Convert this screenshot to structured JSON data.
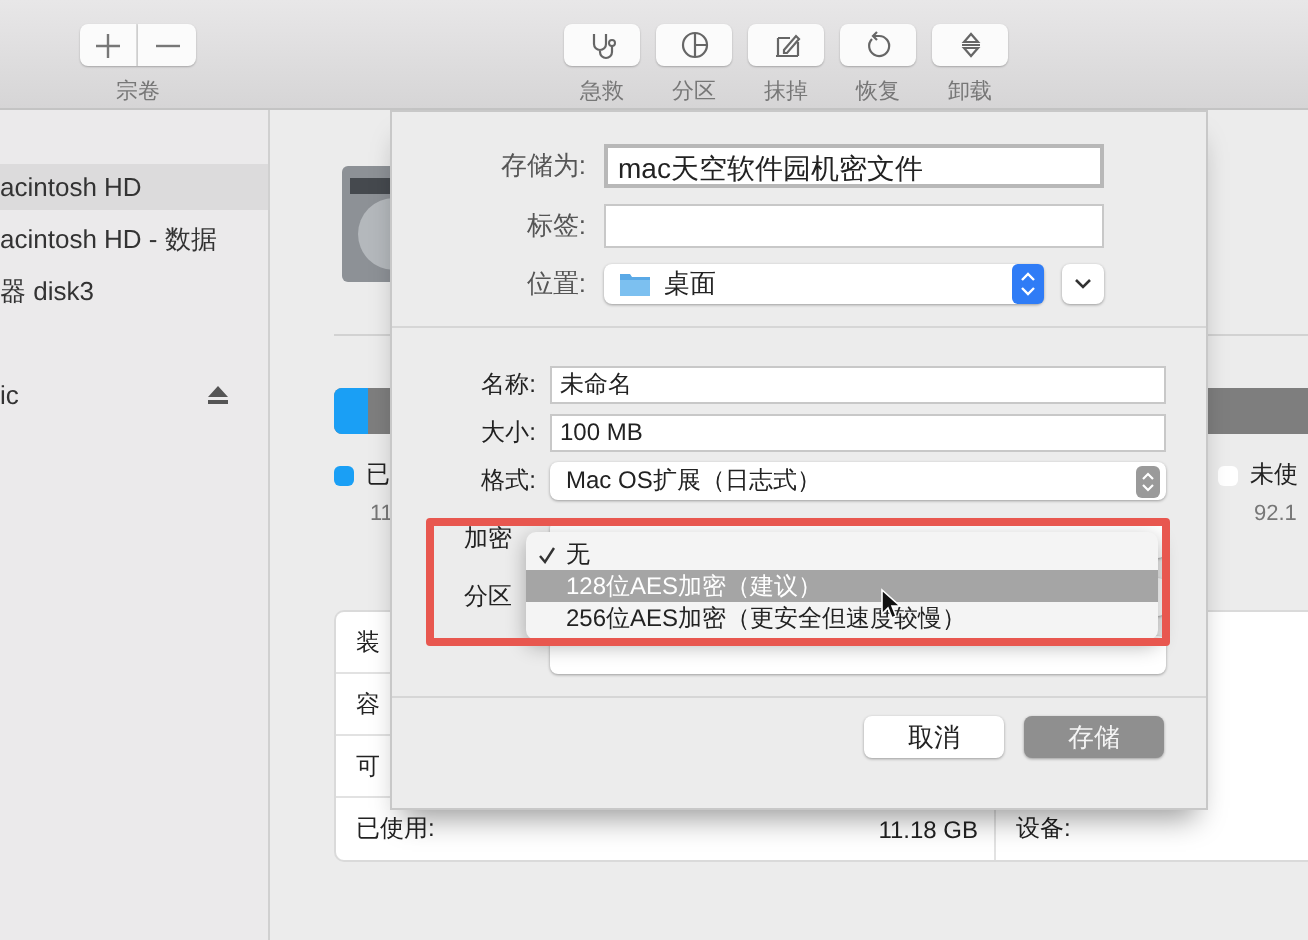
{
  "toolbar": {
    "volume_group": {
      "label": "宗卷"
    },
    "actions": [
      {
        "label": "急救"
      },
      {
        "label": "分区"
      },
      {
        "label": "抹掉"
      },
      {
        "label": "恢复"
      },
      {
        "label": "卸载"
      }
    ]
  },
  "sidebar": {
    "items": [
      {
        "label": "acintosh HD",
        "selected": true,
        "eject": false
      },
      {
        "label": "acintosh HD - 数据",
        "selected": false,
        "eject": false
      },
      {
        "label": "器 disk3",
        "selected": false,
        "eject": false
      },
      {
        "label": "ic",
        "selected": false,
        "eject": true
      }
    ]
  },
  "main": {
    "legend": [
      {
        "label": "已",
        "value": "11",
        "color": "#1a9ff5"
      },
      {
        "label": "未使",
        "value": "92.1",
        "color": "#ffffff"
      }
    ],
    "info_rows": [
      {
        "left_label": "装"
      },
      {
        "left_label": "容"
      },
      {
        "left_label": "可"
      },
      {
        "left_label": "已使用:",
        "left_value": "11.18 GB",
        "right_label": "设备:"
      }
    ]
  },
  "dialog": {
    "save_as": {
      "label": "存储为:",
      "value": "mac天空软件园机密文件"
    },
    "tags": {
      "label": "标签:"
    },
    "location": {
      "label": "位置:",
      "value": "桌面"
    },
    "name": {
      "label": "名称:",
      "value": "未命名"
    },
    "size": {
      "label": "大小:",
      "value": "100 MB"
    },
    "format": {
      "label": "格式:",
      "value": "Mac OS扩展（日志式）"
    },
    "encryption": {
      "label": "加密",
      "menu": [
        {
          "label": "无",
          "checked": true,
          "selected": false
        },
        {
          "label": "128位AES加密（建议）",
          "checked": false,
          "selected": true
        },
        {
          "label": "256位AES加密（更安全但速度较慢）",
          "checked": false,
          "selected": false
        }
      ]
    },
    "partition": {
      "label": "分区"
    },
    "buttons": [
      {
        "label": "取消",
        "kind": "normal"
      },
      {
        "label": "存储",
        "kind": "default"
      }
    ]
  }
}
